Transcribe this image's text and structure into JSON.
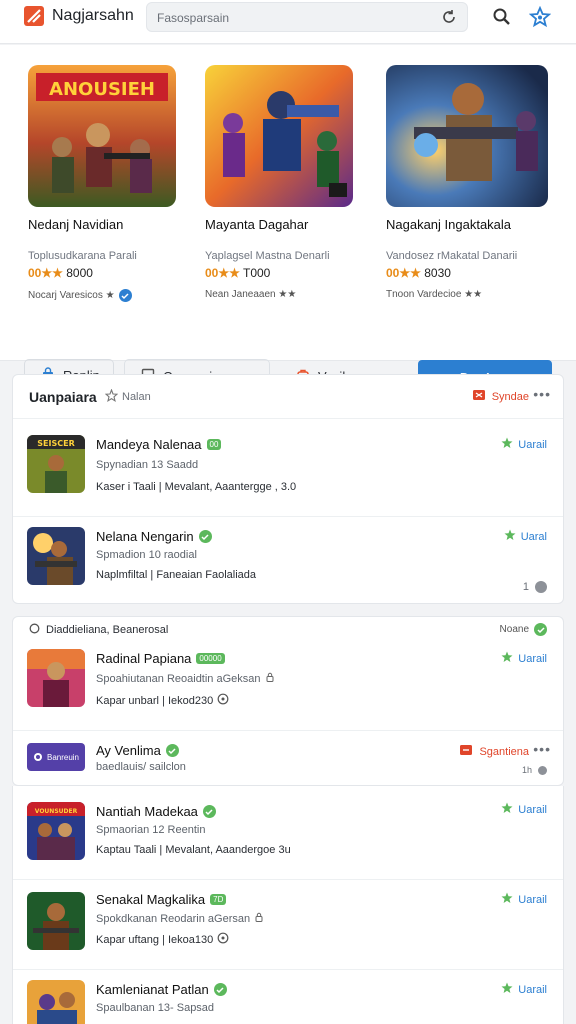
{
  "app": {
    "title": "Nagjarsahn"
  },
  "search": {
    "placeholder": "Fasosparsain"
  },
  "featured": [
    {
      "title": "Nedanj Navidian",
      "subtitle": "Toplusudkarana Parali",
      "rating": "00★★",
      "price": "8000",
      "meta": "Nocarj Varesicos ★"
    },
    {
      "title": "Mayanta Dagahar",
      "subtitle": "Yaplagsel Mastna Denarli",
      "rating": "00★★",
      "price": "T000",
      "meta": "Nean Janeaaen ★★"
    },
    {
      "title": "Nagakanj Ingaktakala",
      "subtitle": "Vandosez rMakatal Danarii",
      "rating": "00★★",
      "price": "8030",
      "meta": "Tnoon Vardecioe ★★"
    }
  ],
  "featured_art_text": {
    "banner": "ANOUSIEH"
  },
  "tabs": [
    {
      "label": "Raplin",
      "icon": "bag-icon"
    },
    {
      "label": "Comnarian",
      "icon": "checkbox-icon"
    },
    {
      "label": "Vasikan",
      "icon": "cart-icon"
    }
  ],
  "primary_button": "DenAmn",
  "section1": {
    "title": "Uanpaiara",
    "subtitle": "Nalan",
    "action": "Syndae",
    "rows": [
      {
        "name": "Mandeya Nalenaa",
        "tag": "00",
        "sub": "Spynadian  13 Saadd",
        "meta": "Kaser i Taali | Mevalant,  Aaantergge , 3.0",
        "action": "Uarail",
        "thumb_text": "SEISCER"
      },
      {
        "name": "Nelana Nengarin",
        "sub": "Spmadion   10 raodial",
        "meta": "Naplmfiltal | Faneaian Faolaliada",
        "action": "Uaral",
        "page": "1"
      }
    ]
  },
  "section2": {
    "title": "Diaddieliana, Beanerosal",
    "action": "Noane",
    "rows": [
      {
        "name": "Radinal Papiana",
        "tag": "00000",
        "sub": "Spoahiutanan Reoaidtin aGeksan",
        "meta": "Kapar unbarl | Iekod230",
        "action": "Uarail"
      }
    ]
  },
  "section3": {
    "head_name": "Ay Venlima",
    "head_sub": "baedlauis/ sailclon",
    "head_logo": "Banreuin",
    "action": "Sgantiena",
    "page": "1h",
    "rows": [
      {
        "name": "Nantiah Madekaa",
        "sub": "Spmaorian  12  Reentin",
        "meta": "Kaptau Taali | Mevalant,  Aaandergoe 3u",
        "action": "Uarail",
        "thumb_text": "VOUNSUDER"
      },
      {
        "name": "Senakal Magkalika",
        "tag": "7D",
        "sub": "Spokdkanan Reodarin aGersan",
        "meta": "Kapar uftang | Iekoa130",
        "action": "Uarail"
      },
      {
        "name": "Kamlenianat Patlan",
        "sub": "Spaulbanan  13-  Sapsad",
        "meta": "",
        "action": "Uarail"
      }
    ]
  },
  "colors": {
    "accent": "#2c7fd1",
    "brand": "#e8542e",
    "success": "#5cb85c",
    "warning": "#e88c19"
  }
}
